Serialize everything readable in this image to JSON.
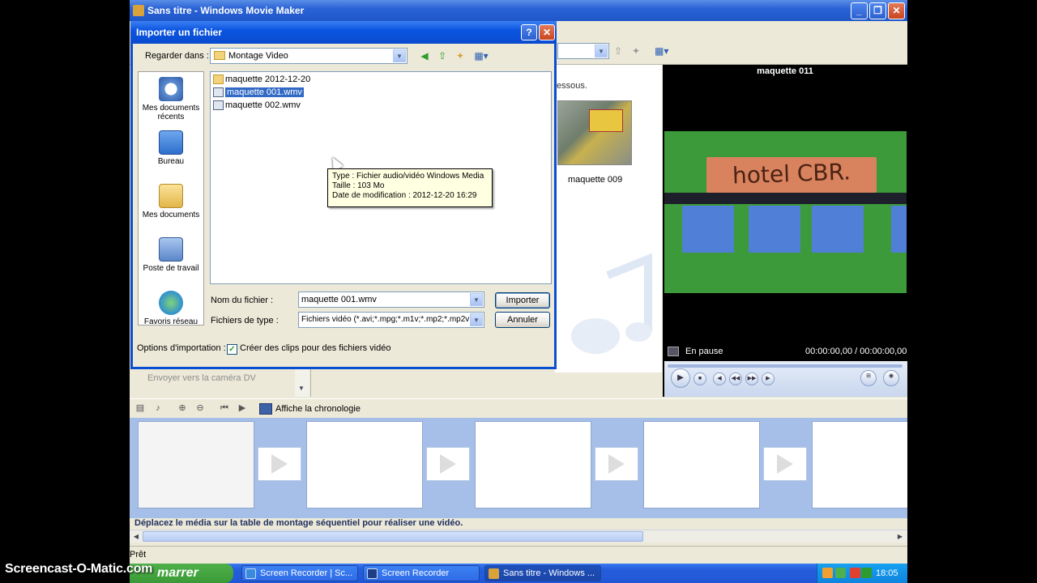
{
  "app": {
    "title": "Sans titre - Windows Movie Maker",
    "status": "Prêt"
  },
  "content_pane": {
    "hint_fragment": "essous.",
    "clip_label": "maquette 009"
  },
  "preview": {
    "title": "maquette 011",
    "sign_text": "hotel CBR.",
    "status": "En pause",
    "time": "00:00:00,00 / 00:00:00,00"
  },
  "tasks": {
    "dv_link": "Envoyer vers la caméra DV"
  },
  "storyboard": {
    "timeline_toggle": "Affiche la chronologie",
    "hint": "Déplacez le média sur la table de montage séquentiel pour réaliser une vidéo."
  },
  "dialog": {
    "title": "Importer un fichier",
    "look_in_label": "Regarder dans :",
    "look_in_value": "Montage Video",
    "places": [
      {
        "label": "Mes documents récents",
        "icon": "recent-documents-icon"
      },
      {
        "label": "Bureau",
        "icon": "desktop-icon"
      },
      {
        "label": "Mes documents",
        "icon": "my-documents-icon"
      },
      {
        "label": "Poste de travail",
        "icon": "my-computer-icon"
      },
      {
        "label": "Favoris réseau",
        "icon": "network-places-icon"
      }
    ],
    "files": [
      {
        "name": "maquette 2012-12-20",
        "kind": "folder",
        "selected": false
      },
      {
        "name": "maquette 001.wmv",
        "kind": "wmv",
        "selected": true
      },
      {
        "name": "maquette 002.wmv",
        "kind": "wmv",
        "selected": false
      }
    ],
    "tooltip": {
      "type_line": "Type : Fichier audio/vidéo Windows Media",
      "size_line": "Taille  :  103 Mo",
      "date_line": "Date de modification : 2012-12-20 16:29"
    },
    "filename_label": "Nom du fichier :",
    "filename_value": "maquette 001.wmv",
    "filetype_label": "Fichiers de type :",
    "filetype_value": "Fichiers vidéo (*.avi;*.mpg;*.m1v;*.mp2;*.mp2v;",
    "import_button": "Importer",
    "cancel_button": "Annuler",
    "import_options_label": "Options d'importation :",
    "create_clips_label": "Créer des clips pour des fichiers vidéo",
    "create_clips_checked": true
  },
  "taskbar": {
    "start_label": "marrer",
    "tasks": [
      {
        "label": "Screen Recorder | Sc...",
        "active": false
      },
      {
        "label": "Screen Recorder",
        "active": false
      },
      {
        "label": "Sans titre - Windows ...",
        "active": true
      }
    ],
    "clock": "18:05"
  },
  "watermark": "Screencast-O-Matic.com",
  "colors": {
    "xp_blue": "#0a4fd2",
    "selection": "#316ac5",
    "storyboard_bg": "#a6bfe8",
    "start_green": "#3b9a37"
  }
}
